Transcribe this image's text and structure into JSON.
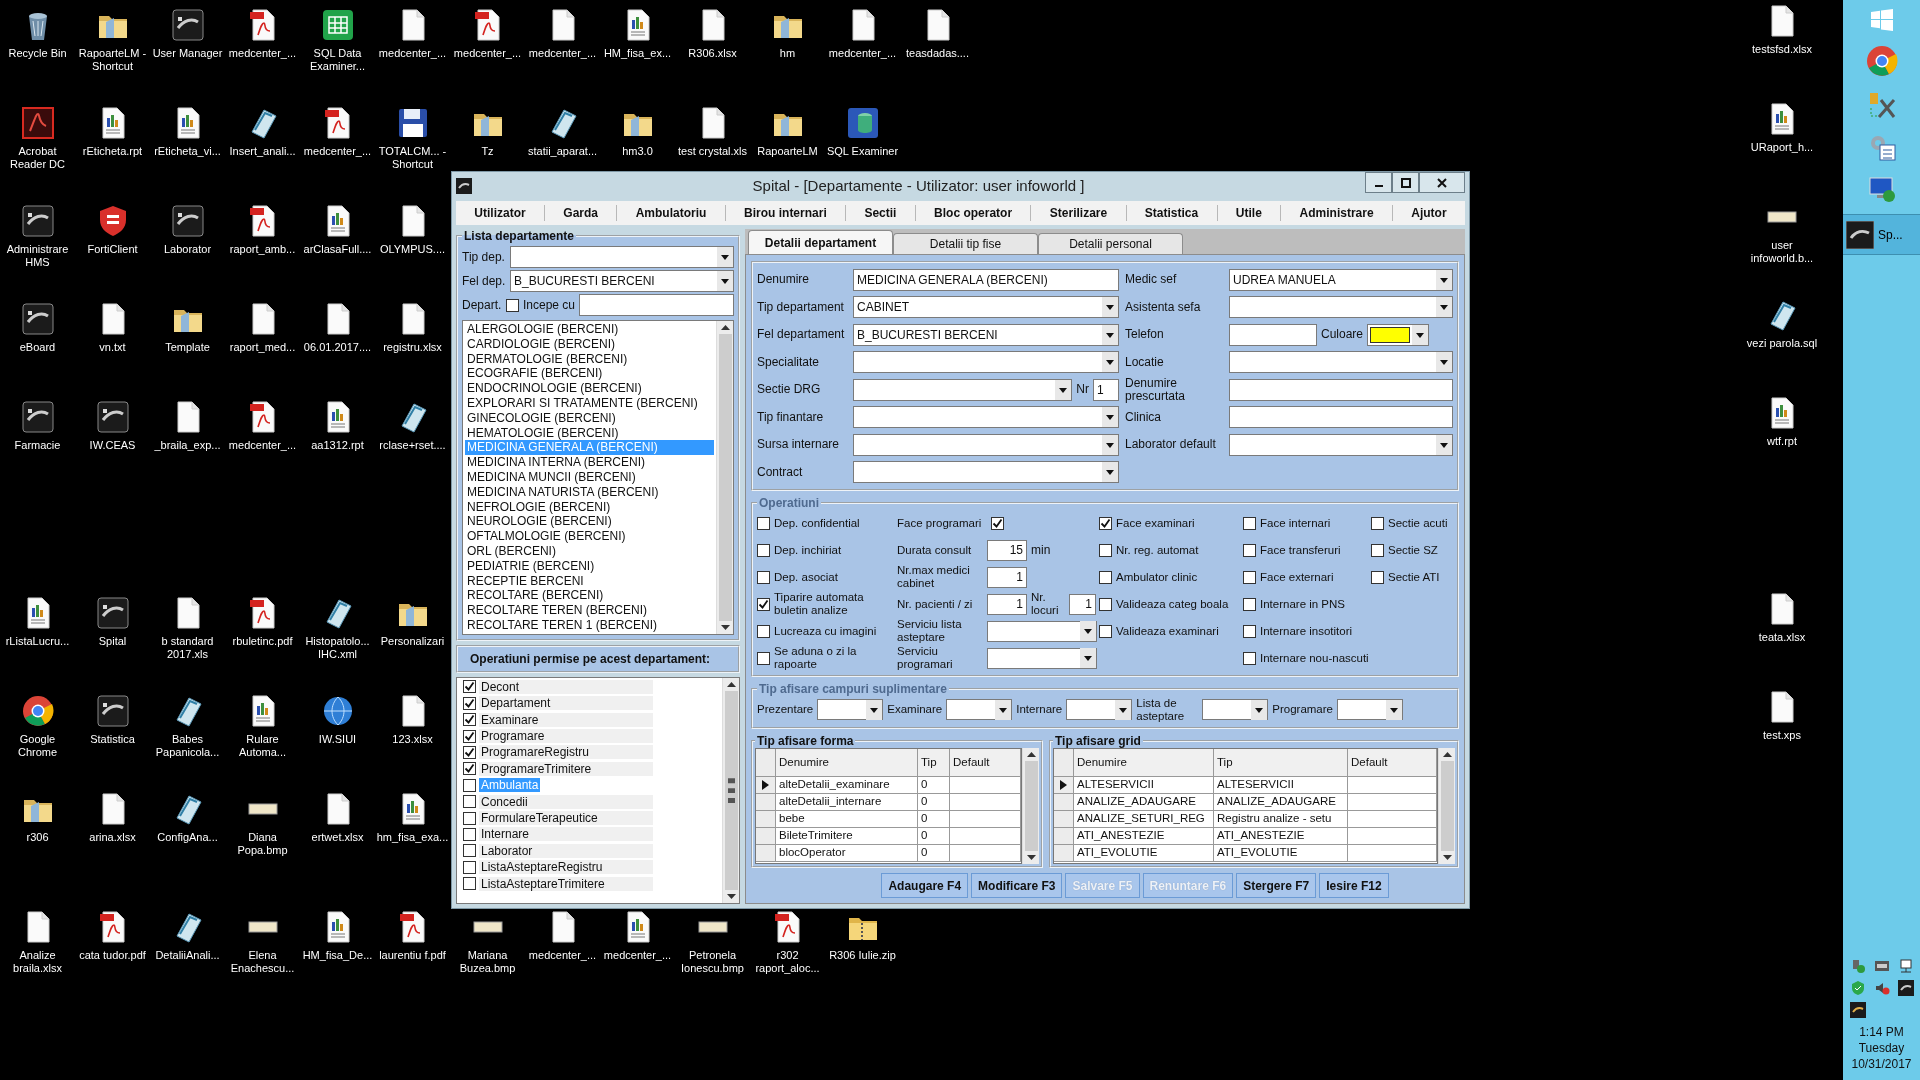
{
  "desktop": {
    "icons": [
      {
        "label": "Recycle Bin",
        "kind": "recycle"
      },
      {
        "label": "RapoarteLM - Shortcut",
        "kind": "folder"
      },
      {
        "label": "User Manager",
        "kind": "app"
      },
      {
        "label": "medcenter_...",
        "kind": "pdf"
      },
      {
        "label": "SQL Data Examiner...",
        "kind": "green"
      },
      {
        "label": "medcenter_...",
        "kind": "file"
      },
      {
        "label": "medcenter_...",
        "kind": "pdf"
      },
      {
        "label": "medcenter_...",
        "kind": "file"
      },
      {
        "label": "HM_fisa_ex...",
        "kind": "report"
      },
      {
        "label": "R306.xlsx",
        "kind": "file"
      },
      {
        "label": "hm",
        "kind": "folder"
      },
      {
        "label": "medcenter_...",
        "kind": "file"
      },
      {
        "label": "teasdadas....",
        "kind": "file"
      },
      {
        "label": "Acrobat Reader DC",
        "kind": "acrobat"
      },
      {
        "label": "rEticheta.rpt",
        "kind": "report"
      },
      {
        "label": "rEticheta_vi...",
        "kind": "report"
      },
      {
        "label": "Insert_anali...",
        "kind": "notepad"
      },
      {
        "label": "medcenter_...",
        "kind": "pdf"
      },
      {
        "label": "TOTALCM... - Shortcut",
        "kind": "floppy"
      },
      {
        "label": "Tz",
        "kind": "folder"
      },
      {
        "label": "statii_aparat...",
        "kind": "notepad"
      },
      {
        "label": "hm3.0",
        "kind": "folder"
      },
      {
        "label": "test crystal.xls",
        "kind": "file"
      },
      {
        "label": "RapoarteLM",
        "kind": "folder"
      },
      {
        "label": "SQL Examiner",
        "kind": "database"
      },
      {
        "label": "Administrare HMS",
        "kind": "app"
      },
      {
        "label": "FortiClient",
        "kind": "shield"
      },
      {
        "label": "Laborator",
        "kind": "app"
      },
      {
        "label": "raport_amb...",
        "kind": "pdf"
      },
      {
        "label": "arClasaFull....",
        "kind": "report"
      },
      {
        "label": "OLYMPUS....",
        "kind": "file"
      },
      {
        "label": "eBoard",
        "kind": "app"
      },
      {
        "label": "vn.txt",
        "kind": "file"
      },
      {
        "label": "Template",
        "kind": "folder"
      },
      {
        "label": "raport_med...",
        "kind": "file"
      },
      {
        "label": "06.01.2017....",
        "kind": "file"
      },
      {
        "label": "registru.xlsx",
        "kind": "file"
      },
      {
        "label": "Farmacie",
        "kind": "app"
      },
      {
        "label": "IW.CEAS",
        "kind": "app"
      },
      {
        "label": "_braila_exp...",
        "kind": "file"
      },
      {
        "label": "medcenter_...",
        "kind": "pdf"
      },
      {
        "label": "aa1312.rpt",
        "kind": "report"
      },
      {
        "label": "rclase+rset....",
        "kind": "notepad"
      },
      {
        "label": "rListaLucru...",
        "kind": "report"
      },
      {
        "label": "Spital",
        "kind": "app"
      },
      {
        "label": "b standard 2017.xls",
        "kind": "file"
      },
      {
        "label": "rbuletinc.pdf",
        "kind": "pdf"
      },
      {
        "label": "Histopatolo... IHC.xml",
        "kind": "notepad"
      },
      {
        "label": "Personalizari",
        "kind": "folder"
      },
      {
        "label": "Google Chrome",
        "kind": "chrome"
      },
      {
        "label": "Statistica",
        "kind": "app"
      },
      {
        "label": "Babes Papanicola...",
        "kind": "notepad"
      },
      {
        "label": "Rulare Automa...",
        "kind": "report"
      },
      {
        "label": "IW.SIUI",
        "kind": "globe"
      },
      {
        "label": "123.xlsx",
        "kind": "file"
      },
      {
        "label": "r306",
        "kind": "folder"
      },
      {
        "label": "arina.xlsx",
        "kind": "file"
      },
      {
        "label": "ConfigAna...",
        "kind": "notepad"
      },
      {
        "label": "Diana Popa.bmp",
        "kind": "image"
      },
      {
        "label": "ertwet.xlsx",
        "kind": "file"
      },
      {
        "label": "hm_fisa_exa...",
        "kind": "report"
      },
      {
        "label": "Analize braila.xlsx",
        "kind": "file"
      },
      {
        "label": "cata tudor.pdf",
        "kind": "pdf"
      },
      {
        "label": "DetaliiAnali...",
        "kind": "notepad"
      },
      {
        "label": "Elena Enachescu...",
        "kind": "image"
      },
      {
        "label": "HM_fisa_De...",
        "kind": "report"
      },
      {
        "label": "laurentiu f.pdf",
        "kind": "pdf"
      },
      {
        "label": "Mariana Buzea.bmp",
        "kind": "image"
      },
      {
        "label": "medcenter_...",
        "kind": "file"
      },
      {
        "label": "medcenter_...",
        "kind": "report"
      },
      {
        "label": "Petronela Ionescu.bmp",
        "kind": "image"
      },
      {
        "label": "r302 raport_aloc...",
        "kind": "pdf"
      },
      {
        "label": "R306 Iulie.zip",
        "kind": "zip"
      }
    ],
    "right_icons": [
      {
        "label": "testsfsd.xlsx",
        "kind": "file"
      },
      {
        "label": "URaport_h...",
        "kind": "report"
      },
      {
        "label": "user infoworld.b...",
        "kind": "image"
      },
      {
        "label": "vezi parola.sql",
        "kind": "notepad"
      },
      {
        "label": "wtf.rpt",
        "kind": "report"
      },
      {
        "label": "teata.xlsx",
        "kind": "file"
      },
      {
        "label": "test.xps",
        "kind": "file"
      }
    ]
  },
  "taskbar": {
    "apps": [
      {
        "label": "Sp...",
        "selected": true
      }
    ],
    "clock": {
      "time": "1:14 PM",
      "day": "Tuesday",
      "date": "10/31/2017"
    }
  },
  "window": {
    "title": "Spital - [Departamente - Utilizator: user infoworld ]",
    "menu": [
      "Utilizator",
      "Garda",
      "Ambulatoriu",
      "Birou internari",
      "Sectii",
      "Bloc operator",
      "Sterilizare",
      "Statistica",
      "Utile",
      "Administrare",
      "Ajutor"
    ],
    "left_panel": {
      "title": "Lista departamente",
      "filters": [
        {
          "label": "Tip dep.",
          "kind": "combo"
        },
        {
          "label": "Fel dep.",
          "kind": "combo",
          "value": "B_BUCURESTI BERCENI"
        },
        {
          "label": "Depart.",
          "kind": "check",
          "checkbox_label": "Incepe cu",
          "checked": false
        }
      ],
      "departments": [
        {
          "label": "ALERGOLOGIE (BERCENI)",
          "selected": false
        },
        {
          "label": "CARDIOLOGIE (BERCENI)",
          "selected": false
        },
        {
          "label": "DERMATOLOGIE (BERCENI)",
          "selected": false
        },
        {
          "label": "ECOGRAFIE (BERCENI)",
          "selected": false
        },
        {
          "label": "ENDOCRINOLOGIE (BERCENI)",
          "selected": false
        },
        {
          "label": "EXPLORARI SI TRATAMENTE (BERCENI)",
          "selected": false
        },
        {
          "label": "GINECOLOGIE (BERCENI)",
          "selected": false
        },
        {
          "label": "HEMATOLOGIE (BERCENI)",
          "selected": false
        },
        {
          "label": "MEDICINA GENERALA (BERCENI)",
          "selected": true
        },
        {
          "label": "MEDICINA INTERNA (BERCENI)",
          "selected": false
        },
        {
          "label": "MEDICINA MUNCII (BERCENI)",
          "selected": false
        },
        {
          "label": "MEDICINA NATURISTA (BERCENI)",
          "selected": false
        },
        {
          "label": "NEFROLOGIE (BERCENI)",
          "selected": false
        },
        {
          "label": "NEUROLOGIE (BERCENI)",
          "selected": false
        },
        {
          "label": "OFTALMOLOGIE (BERCENI)",
          "selected": false
        },
        {
          "label": "ORL (BERCENI)",
          "selected": false
        },
        {
          "label": "PEDIATRIE (BERCENI)",
          "selected": false
        },
        {
          "label": "RECEPTIE BERCENI",
          "selected": false
        },
        {
          "label": "RECOLTARE (BERCENI)",
          "selected": false
        },
        {
          "label": "RECOLTARE TEREN (BERCENI)",
          "selected": false
        },
        {
          "label": "RECOLTARE TEREN 1 (BERCENI)",
          "selected": false
        }
      ],
      "operations": {
        "title": "Operatiuni permise pe acest departament:",
        "items": [
          {
            "label": "Decont",
            "checked": true,
            "selected": false
          },
          {
            "label": "Departament",
            "checked": true,
            "selected": false
          },
          {
            "label": "Examinare",
            "checked": true,
            "selected": false
          },
          {
            "label": "Programare",
            "checked": true,
            "selected": false
          },
          {
            "label": "ProgramareRegistru",
            "checked": true,
            "selected": false
          },
          {
            "label": "ProgramareTrimitere",
            "checked": true,
            "selected": false
          },
          {
            "label": "Ambulanta",
            "checked": false,
            "selected": true
          },
          {
            "label": "Concedii",
            "checked": false,
            "selected": false
          },
          {
            "label": "FormulareTerapeutice",
            "checked": false,
            "selected": false
          },
          {
            "label": "Internare",
            "checked": false,
            "selected": false
          },
          {
            "label": "Laborator",
            "checked": false,
            "selected": false
          },
          {
            "label": "ListaAsteptareRegistru",
            "checked": false,
            "selected": false
          },
          {
            "label": "ListaAsteptareTrimitere",
            "checked": false,
            "selected": false
          }
        ]
      }
    },
    "tabs": [
      {
        "label": "Detalii departament",
        "selected": true
      },
      {
        "label": "Detalii tip fise",
        "selected": false
      },
      {
        "label": "Detalii personal",
        "selected": false
      }
    ],
    "details": {
      "form": {
        "left": [
          {
            "label": "Denumire",
            "kind": "text",
            "value": "MEDICINA GENERALA (BERCENI)"
          },
          {
            "label": "Tip departament",
            "kind": "combo",
            "value": "CABINET"
          },
          {
            "label": "Fel departament",
            "kind": "combo",
            "value": "B_BUCURESTI BERCENI"
          },
          {
            "label": "Specialitate",
            "kind": "combo"
          },
          {
            "label": "Sectie DRG",
            "kind": "combo",
            "extra": {
              "label": "Nr",
              "value": "1"
            }
          },
          {
            "label": "Tip finantare",
            "kind": "combo"
          },
          {
            "label": "Sursa internare",
            "kind": "combo"
          },
          {
            "label": "Contract",
            "kind": "combo"
          }
        ],
        "right": [
          {
            "label": "Medic sef",
            "kind": "combo",
            "value": "UDREA MANUELA"
          },
          {
            "label": "Asistenta sefa",
            "kind": "combo"
          },
          {
            "label": "Telefon",
            "kind": "text",
            "extra": {
              "label": "Culoare",
              "color": "#ffff00"
            }
          },
          {
            "label": "Locatie",
            "kind": "combo"
          },
          {
            "label": "Denumire prescurtata",
            "kind": "text"
          },
          {
            "label": "Clinica",
            "kind": "text"
          },
          {
            "label": "Laborator default",
            "kind": "combo"
          }
        ]
      },
      "operations": {
        "title": "Operatiuni",
        "columns": [
          [
            {
              "label": "Dep. confidential",
              "kind": "checkbox",
              "checked": false
            },
            {
              "label": "Dep. inchiriat",
              "kind": "checkbox",
              "checked": false
            },
            {
              "label": "Dep. asociat",
              "kind": "checkbox",
              "checked": false
            },
            {
              "label": "Tiparire automata buletin analize",
              "kind": "checkbox",
              "checked": true
            },
            {
              "label": "Lucreaza cu imagini",
              "kind": "checkbox",
              "checked": false
            },
            {
              "label": "Se aduna o zi la rapoarte",
              "kind": "checkbox",
              "checked": false
            }
          ],
          [
            {
              "label": "Face programari",
              "kind": "checkafter",
              "checked": true
            },
            {
              "label": "Durata consult",
              "kind": "number",
              "value": "15",
              "unit": "min"
            },
            {
              "label": "Nr.max medici cabinet",
              "kind": "number",
              "value": "1"
            },
            {
              "label": "Nr. pacienti / zi",
              "kind": "number",
              "value": "1",
              "extra": {
                "label": "Nr. locuri",
                "value": "1"
              }
            },
            {
              "label": "Serviciu lista asteptare",
              "kind": "combo"
            },
            {
              "label": "Serviciu programari",
              "kind": "combo"
            }
          ],
          [
            {
              "label": "Face examinari",
              "kind": "checkbox",
              "checked": true
            },
            {
              "label": "Nr. reg. automat",
              "kind": "checkbox",
              "checked": false
            },
            {
              "label": "Ambulator clinic",
              "kind": "checkbox",
              "checked": false
            },
            {
              "label": "Valideaza categ boala",
              "kind": "checkbox",
              "checked": false
            },
            {
              "label": "Valideaza examinari",
              "kind": "checkbox",
              "checked": false
            }
          ],
          [
            {
              "label": "Face internari",
              "kind": "checkbox",
              "checked": false
            },
            {
              "label": "Face transferuri",
              "kind": "checkbox",
              "checked": false
            },
            {
              "label": "Face externari",
              "kind": "checkbox",
              "checked": false
            },
            {
              "label": "Internare  in PNS",
              "kind": "checkbox",
              "checked": false
            },
            {
              "label": "Internare insotitori",
              "kind": "checkbox",
              "checked": false
            },
            {
              "label": "Internare nou-nascuti",
              "kind": "checkbox",
              "checked": false
            }
          ],
          [
            {
              "label": "Sectie acuti",
              "kind": "checkbox",
              "checked": false
            },
            {
              "label": "Sectie SZ",
              "kind": "checkbox",
              "checked": false
            },
            {
              "label": "Sectie ATI",
              "kind": "checkbox",
              "checked": false
            }
          ]
        ]
      },
      "extra_fields": {
        "title": "Tip afisare campuri suplimentare",
        "fields": [
          "Prezentare",
          "Examinare",
          "Internare",
          "Lista de asteptare",
          "Programare"
        ]
      },
      "grids": [
        {
          "title": "Tip afisare forma",
          "columns": [
            "Denumire",
            "Tip",
            "Default"
          ],
          "rows": [
            {
              "cells": [
                "alteDetalii_examinare",
                "0"
              ],
              "selected": true
            },
            {
              "cells": [
                "alteDetalii_internare",
                "0"
              ],
              "selected": false
            },
            {
              "cells": [
                "bebe",
                "0"
              ],
              "selected": false
            },
            {
              "cells": [
                "BileteTrimitere",
                "0"
              ],
              "selected": false
            },
            {
              "cells": [
                "blocOperator",
                "0"
              ],
              "selected": false
            }
          ]
        },
        {
          "title": "Tip afisare grid",
          "columns": [
            "Denumire",
            "Tip",
            "Default"
          ],
          "rows": [
            {
              "cells": [
                "ALTESERVICII",
                "ALTESERVICII"
              ],
              "selected": true
            },
            {
              "cells": [
                "ANALIZE_ADAUGARE",
                "ANALIZE_ADAUGARE"
              ],
              "selected": false
            },
            {
              "cells": [
                "ANALIZE_SETURI_REG",
                "Registru analize - setu"
              ],
              "selected": false
            },
            {
              "cells": [
                "ATI_ANESTEZIE",
                "ATI_ANESTEZIE"
              ],
              "selected": false
            },
            {
              "cells": [
                "ATI_EVOLUTIE",
                "ATI_EVOLUTIE"
              ],
              "selected": false
            }
          ]
        }
      ],
      "buttons": [
        {
          "label": "Adaugare F4",
          "disabled": false
        },
        {
          "label": "Modificare F3",
          "disabled": false
        },
        {
          "label": "Salvare F5",
          "disabled": true
        },
        {
          "label": "Renuntare F6",
          "disabled": true
        },
        {
          "label": "Stergere F7",
          "disabled": false
        },
        {
          "label": "Iesire F12",
          "disabled": false
        }
      ]
    }
  }
}
